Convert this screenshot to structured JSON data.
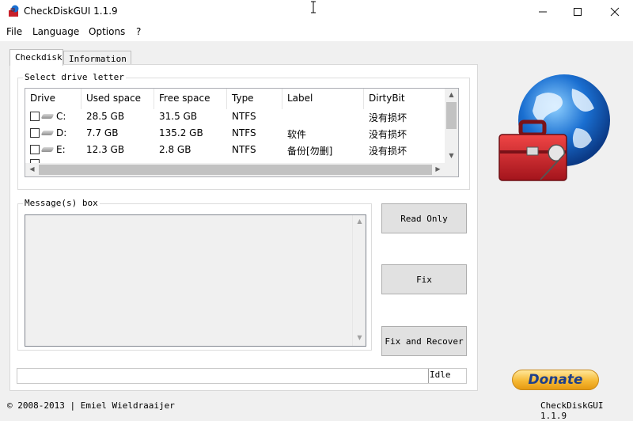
{
  "window": {
    "title": "CheckDiskGUI 1.1.9"
  },
  "menu": [
    "File",
    "Language",
    "Options",
    "?"
  ],
  "tabs": [
    "Checkdisk",
    "Information"
  ],
  "drive_group": {
    "legend": "Select drive letter",
    "columns": [
      "Drive",
      "Used space",
      "Free space",
      "Type",
      "Label",
      "DirtyBit"
    ],
    "rows": [
      {
        "drive": "C:",
        "used": "28.5 GB",
        "free": "31.5 GB",
        "type": "NTFS",
        "label": "",
        "dirty": "没有损坏"
      },
      {
        "drive": "D:",
        "used": "7.7 GB",
        "free": "135.2 GB",
        "type": "NTFS",
        "label": "软件",
        "dirty": "没有损坏"
      },
      {
        "drive": "E:",
        "used": "12.3 GB",
        "free": "2.8 GB",
        "type": "NTFS",
        "label": "备份[勿删]",
        "dirty": "没有损坏"
      }
    ]
  },
  "message_group": {
    "legend": "Message(s) box"
  },
  "buttons": {
    "read_only": "Read Only",
    "fix": "Fix",
    "fix_recover": "Fix and Recover"
  },
  "status": {
    "text": "Idle"
  },
  "footer": {
    "copyright": "© 2008-2013 | Emiel Wieldraaijer",
    "version": "CheckDiskGUI 1.1.9"
  },
  "donate": {
    "label": "Donate"
  },
  "colors": {
    "window_bg": "#f0f0f0",
    "panel_bg": "#ffffff",
    "donate_gold": "#f6b935",
    "donate_text": "#1d3f8a",
    "toolbox_red": "#c8202a",
    "globe_blue": "#1a6fd1"
  }
}
